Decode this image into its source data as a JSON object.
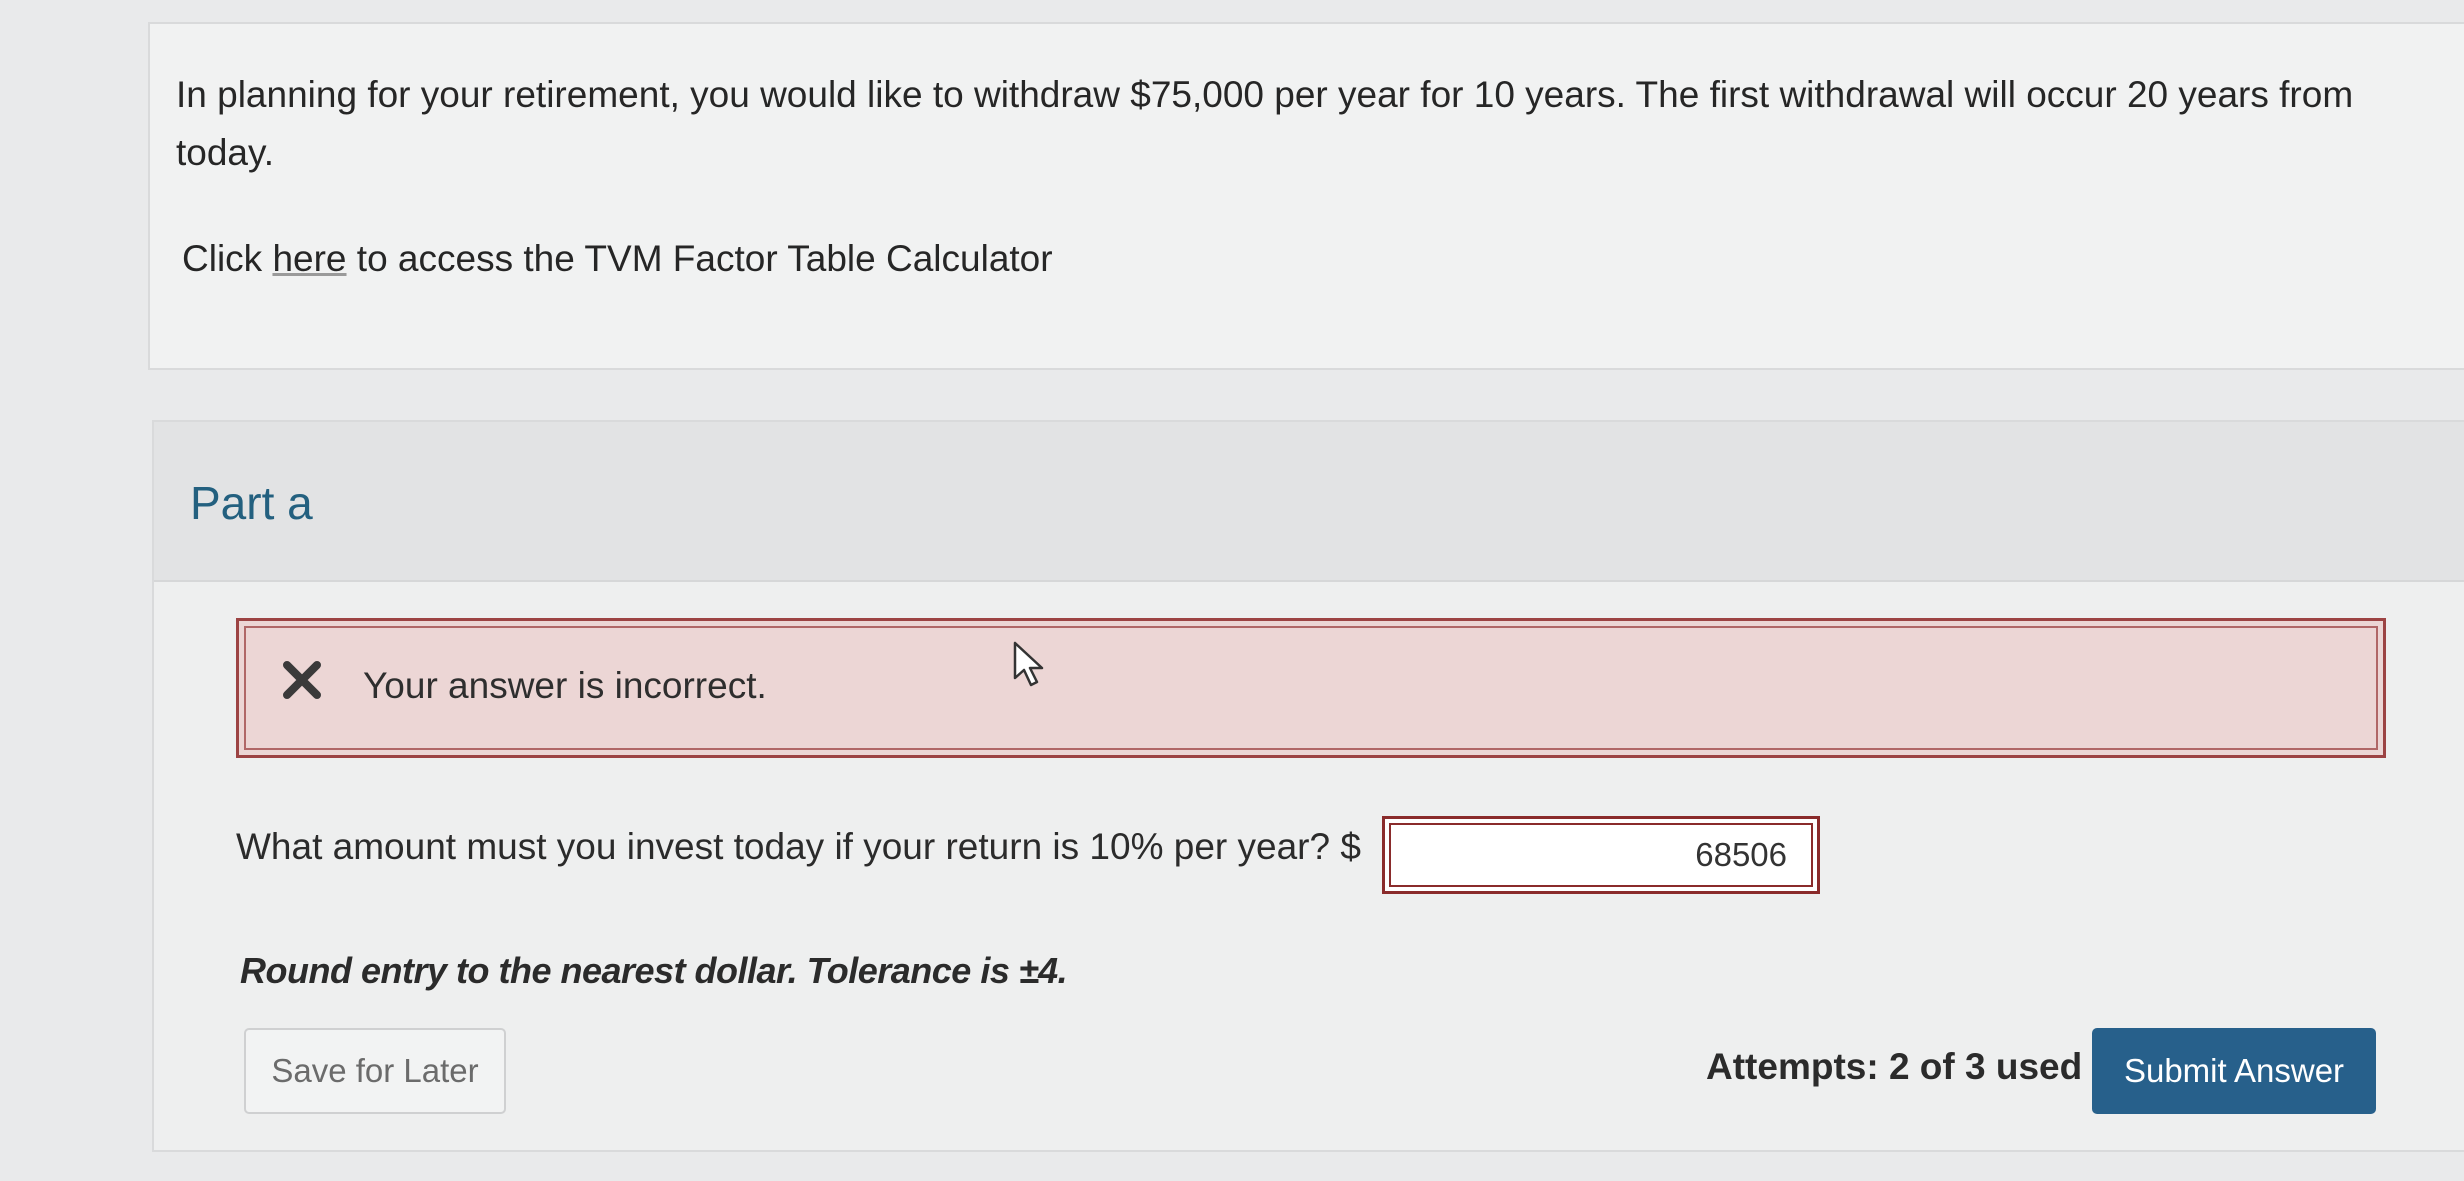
{
  "question": {
    "text": "In planning for your retirement, you would like to withdraw $75,000 per year for 10 years. The first withdrawal will occur 20 years from today.",
    "tvm_prefix": "Click ",
    "tvm_link_text": "here",
    "tvm_suffix": " to access the TVM Factor Table Calculator"
  },
  "part": {
    "title": "Part a",
    "feedback": {
      "icon": "x-icon",
      "text": "Your answer is incorrect.",
      "status_color": "#9c4343"
    },
    "prompt": "What amount must you invest today if your return is 10% per year? $",
    "answer_value": "68506",
    "tolerance_note": "Round entry to the nearest dollar. Tolerance is ±4.",
    "save_label": "Save for Later",
    "attempts": "Attempts: 2 of 3 used",
    "submit_label": "Submit Answer",
    "accent_color": "#27608b"
  }
}
